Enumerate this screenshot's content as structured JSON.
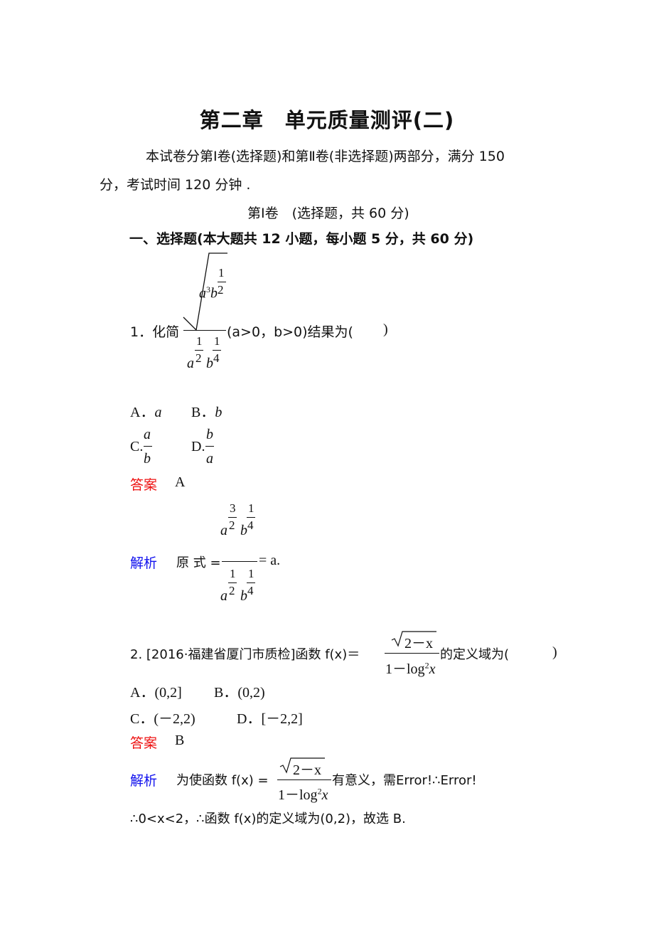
{
  "title": "第二章　单元质量测评(二)",
  "intro": {
    "line1": "本试卷分第Ⅰ卷(选择题)和第Ⅱ卷(非选择题)两部分，满分 150",
    "line2": "分，考试时间 120 分钟 ."
  },
  "section": {
    "header": "第Ⅰ卷　(选择题，共 60 分)",
    "part_title": "一、选择题(本大题共 12 小题，每小题 5 分，共 60 分)"
  },
  "q1": {
    "number": "1．化简",
    "radicand_a": "a",
    "radicand_a_exp": "3",
    "radicand_b": "b",
    "radicand_b_exp_num": "1",
    "radicand_b_exp_den": "2",
    "den_a": "a",
    "den_a_exp_num": "1",
    "den_a_exp_den": "2",
    "den_b": "b",
    "den_b_exp_num": "1",
    "den_b_exp_den": "4",
    "condition": "(a>0，b>0)结果为(",
    "blank_close": ")",
    "options": [
      {
        "label": "A．",
        "value": "a"
      },
      {
        "label": "B．",
        "value": "b"
      },
      {
        "label": "C.",
        "num": "a",
        "den": "b"
      },
      {
        "label": "D.",
        "num": "b",
        "den": "a"
      }
    ],
    "answer_label": "答案",
    "answer": "A",
    "analysis_label": "解析",
    "analysis_prefix": "原 式 =",
    "analysis_num_a_exp": "3",
    "analysis_num_a_den": "2",
    "analysis_num_b_exp": "1",
    "analysis_num_b_den": "4",
    "analysis_den_a_exp": "1",
    "analysis_den_a_den": "2",
    "analysis_den_b_exp": "1",
    "analysis_den_b_den": "4",
    "analysis_result": "= a."
  },
  "q2": {
    "prefix": "2. [2016·福建省厦门市质检]函数 f(x)＝",
    "numerator": "2－x",
    "denominator": "1－log",
    "denominator_sup": "2",
    "denominator_var": "x",
    "suffix": "的定义域为(",
    "blank_close": ")",
    "options": [
      {
        "label": "A．",
        "value": "(0,2]"
      },
      {
        "label": "B．",
        "value": "(0,2)"
      },
      {
        "label": "C．",
        "value": "(－2,2)"
      },
      {
        "label": "D．",
        "value": "[－2,2]"
      }
    ],
    "answer_label": "答案",
    "answer": "B",
    "analysis_label": "解析",
    "analysis_prefix": "为使函数 f(x) =",
    "analysis_suffix": "有意义，需Error!∴Error!",
    "analysis_line2": "∴0<x<2，∴函数 f(x)的定义域为(0,2)，故选 B."
  }
}
